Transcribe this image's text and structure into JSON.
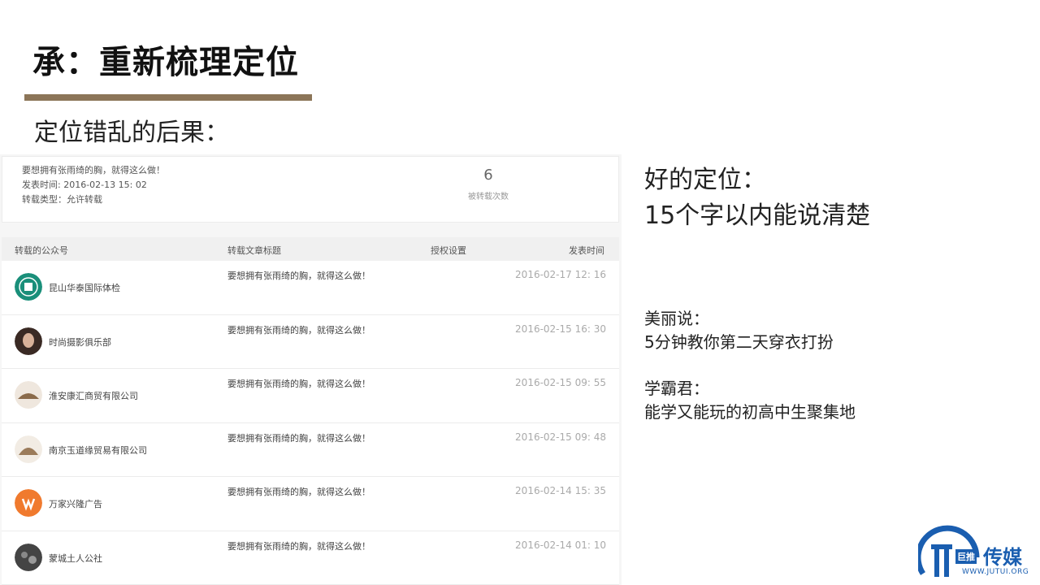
{
  "slide": {
    "title": "承：重新梳理定位",
    "subtitle": "定位错乱的后果："
  },
  "article_info": {
    "title": "要想拥有张雨绮的胸，就得这么做！",
    "publish_time": "发表时间: 2016-02-13 15: 02",
    "repost_type": "转载类型：允许转载",
    "repost_count": "6",
    "repost_count_label": "被转载次数"
  },
  "table": {
    "headers": {
      "account": "转载的公众号",
      "article_title": "转载文章标题",
      "auth": "授权设置",
      "time": "发表时间"
    },
    "rows": [
      {
        "account": "昆山华泰国际体检",
        "title": "要想拥有张雨绮的胸，就得这么做！",
        "time": "2016-02-17 12: 16"
      },
      {
        "account": "时尚摄影俱乐部",
        "title": "要想拥有张雨绮的胸，就得这么做！",
        "time": "2016-02-15 16: 30"
      },
      {
        "account": "淮安康汇商贸有限公司",
        "title": "要想拥有张雨绮的胸，就得这么做！",
        "time": "2016-02-15 09: 55"
      },
      {
        "account": "南京玉道缘贸易有限公司",
        "title": "要想拥有张雨绮的胸，就得这么做！",
        "time": "2016-02-15 09: 48"
      },
      {
        "account": "万家兴隆广告",
        "title": "要想拥有张雨绮的胸，就得这么做！",
        "time": "2016-02-14 15: 35"
      },
      {
        "account": "蒙城土人公社",
        "title": "要想拥有张雨绮的胸，就得这么做！",
        "time": "2016-02-14 01: 10"
      }
    ]
  },
  "right": {
    "good_positioning_line1": "好的定位：",
    "good_positioning_line2": "15个字以内能说清楚",
    "case1_name": "美丽说：",
    "case1_desc": "5分钟教你第二天穿衣打扮",
    "case2_name": "学霸君：",
    "case2_desc": "能学又能玩的初高中生聚集地"
  },
  "logo": {
    "tag": "巨推",
    "name": "传媒",
    "url": "WWW.JUTUI.ORG",
    "color": "#1a5eb0"
  }
}
